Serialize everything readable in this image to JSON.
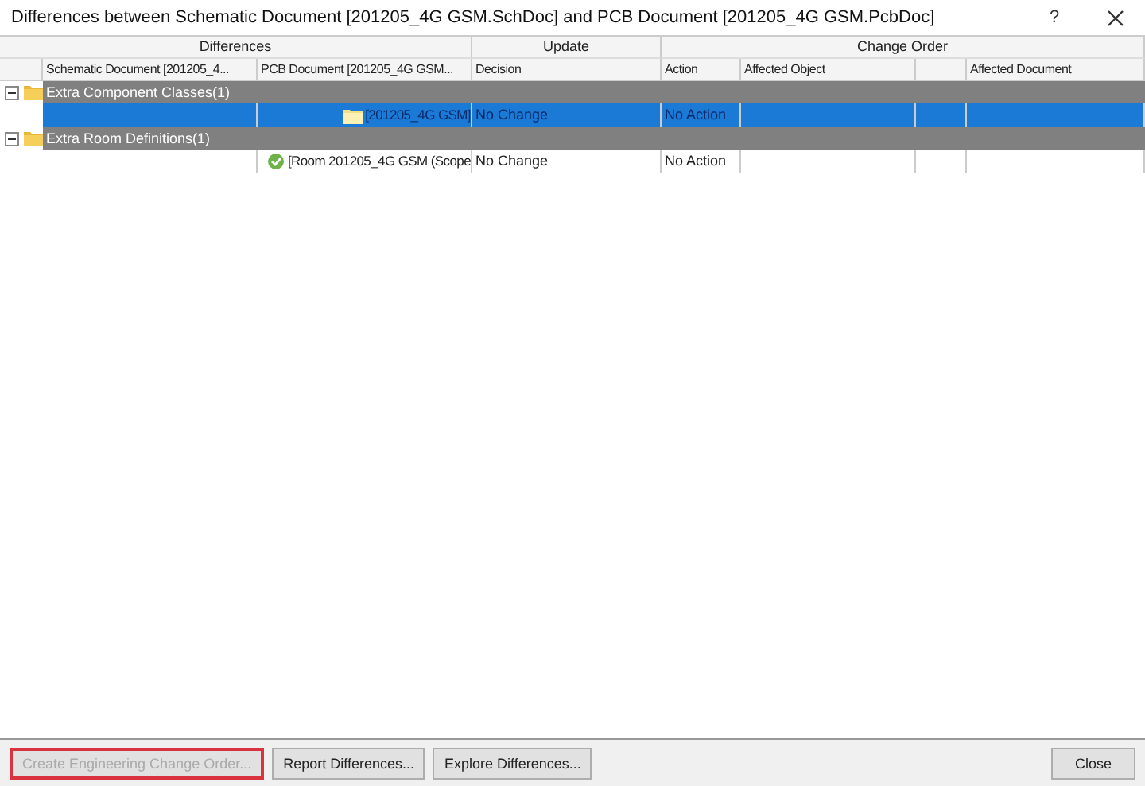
{
  "window": {
    "title": "Differences between Schematic Document [201205_4G GSM.SchDoc] and PCB Document [201205_4G GSM.PcbDoc]",
    "help": "?"
  },
  "table": {
    "column_groups": [
      "Differences",
      "Update",
      "Change Order"
    ],
    "columns": [
      "Schematic Document [201205_4...",
      "PCB Document [201205_4G GSM...",
      "Decision",
      "Action",
      "Affected Object",
      "Affected Document"
    ],
    "groups": [
      {
        "label": "Extra Component Classes(1)",
        "expanded": true,
        "children": [
          {
            "kind": "class",
            "pcb": "[201205_4G GSM]",
            "decision": "No Change",
            "action": "No Action",
            "selected": true
          }
        ]
      },
      {
        "label": "Extra Room Definitions(1)",
        "expanded": true,
        "children": [
          {
            "kind": "room",
            "pcb": "[Room 201205_4G GSM (Scope",
            "decision": "No Change",
            "action": "No Action",
            "selected": false
          }
        ]
      }
    ]
  },
  "buttons": [
    {
      "label": "Create Engineering Change Order...",
      "disabled": true,
      "focused": true
    },
    {
      "label": "Report Differences...",
      "disabled": false,
      "focused": false
    },
    {
      "label": "Explore Differences...",
      "disabled": false,
      "focused": false
    },
    {
      "label": "Close",
      "disabled": false,
      "focused": false
    }
  ]
}
